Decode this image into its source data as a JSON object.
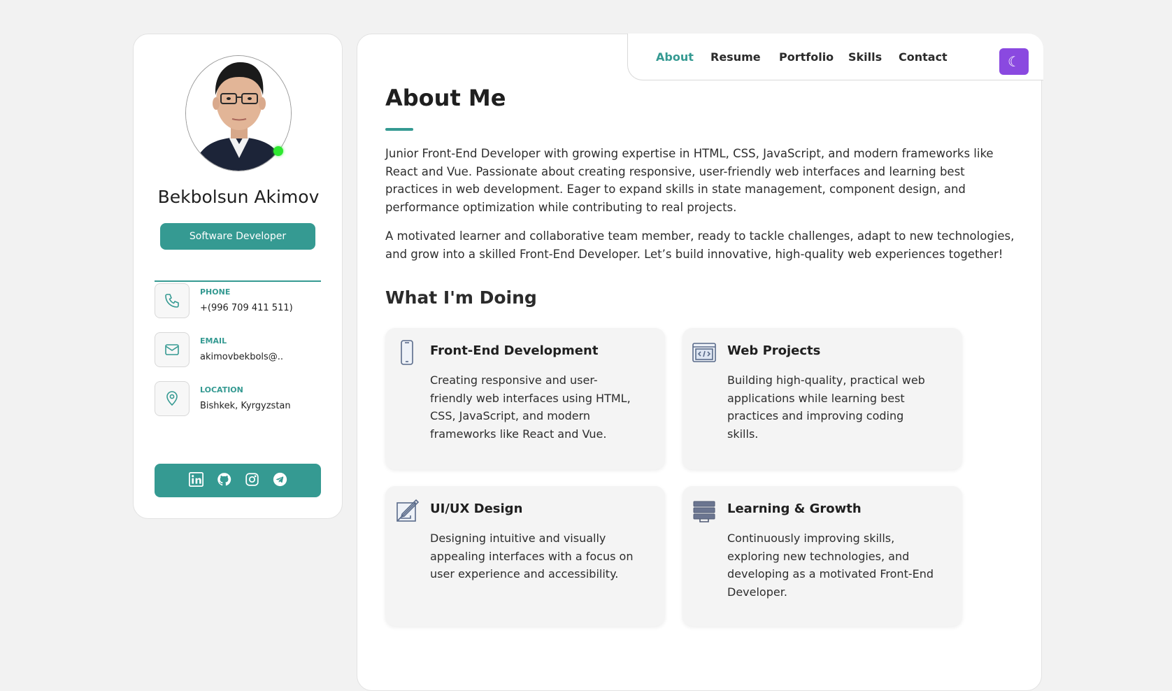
{
  "profile": {
    "name": "Bekbolsun Akimov",
    "role": "Software Developer",
    "status_color": "#2ee830"
  },
  "contacts": [
    {
      "label": "PHONE",
      "value": "+(996 709 411 511)",
      "icon": "phone-icon"
    },
    {
      "label": "EMAIL",
      "value": "akimovbekbols@..",
      "icon": "mail-icon"
    },
    {
      "label": "LOCATION",
      "value": "Bishkek, Kyrgyzstan",
      "icon": "map-pin-icon"
    }
  ],
  "social": [
    "linkedin-icon",
    "github-icon",
    "instagram-icon",
    "telegram-icon"
  ],
  "nav": {
    "items": [
      "About",
      "Resume",
      "Portfolio",
      "Skills",
      "Contact"
    ],
    "active": "About",
    "theme_toggle": "☾"
  },
  "about": {
    "title": "About Me",
    "paragraphs": [
      "Junior Front-End Developer with growing expertise in HTML, CSS, JavaScript, and modern frameworks like React and Vue. Passionate about creating responsive, user-friendly web interfaces and learning best practices in web development. Eager to expand skills in state management, component design, and performance optimization while contributing to real projects.",
      "A motivated learner and collaborative team member, ready to tackle challenges, adapt to new technologies, and grow into a skilled Front-End Developer. Let’s build innovative, high-quality web experiences together!"
    ]
  },
  "services": {
    "title": "What I'm Doing",
    "items": [
      {
        "title": "Front-End Development",
        "description": "Creating responsive and user-friendly web interfaces using HTML, CSS, JavaScript, and modern frameworks like React and Vue.",
        "icon": "mobile-phone-icon"
      },
      {
        "title": "Web Projects",
        "description": "Building high-quality, practical web applications while learning best practices and improving coding skills.",
        "icon": "code-window-icon"
      },
      {
        "title": "UI/UX Design",
        "description": "Designing intuitive and visually appealing interfaces with a focus on user experience and accessibility.",
        "icon": "design-tools-icon"
      },
      {
        "title": "Learning & Growth",
        "description": "Continuously improving skills, exploring new technologies, and developing as a motivated Front-End Developer.",
        "icon": "server-stack-icon"
      }
    ]
  },
  "colors": {
    "accent": "#359a92",
    "toggle": "#8a49e0",
    "background": "#f2f2f2"
  }
}
